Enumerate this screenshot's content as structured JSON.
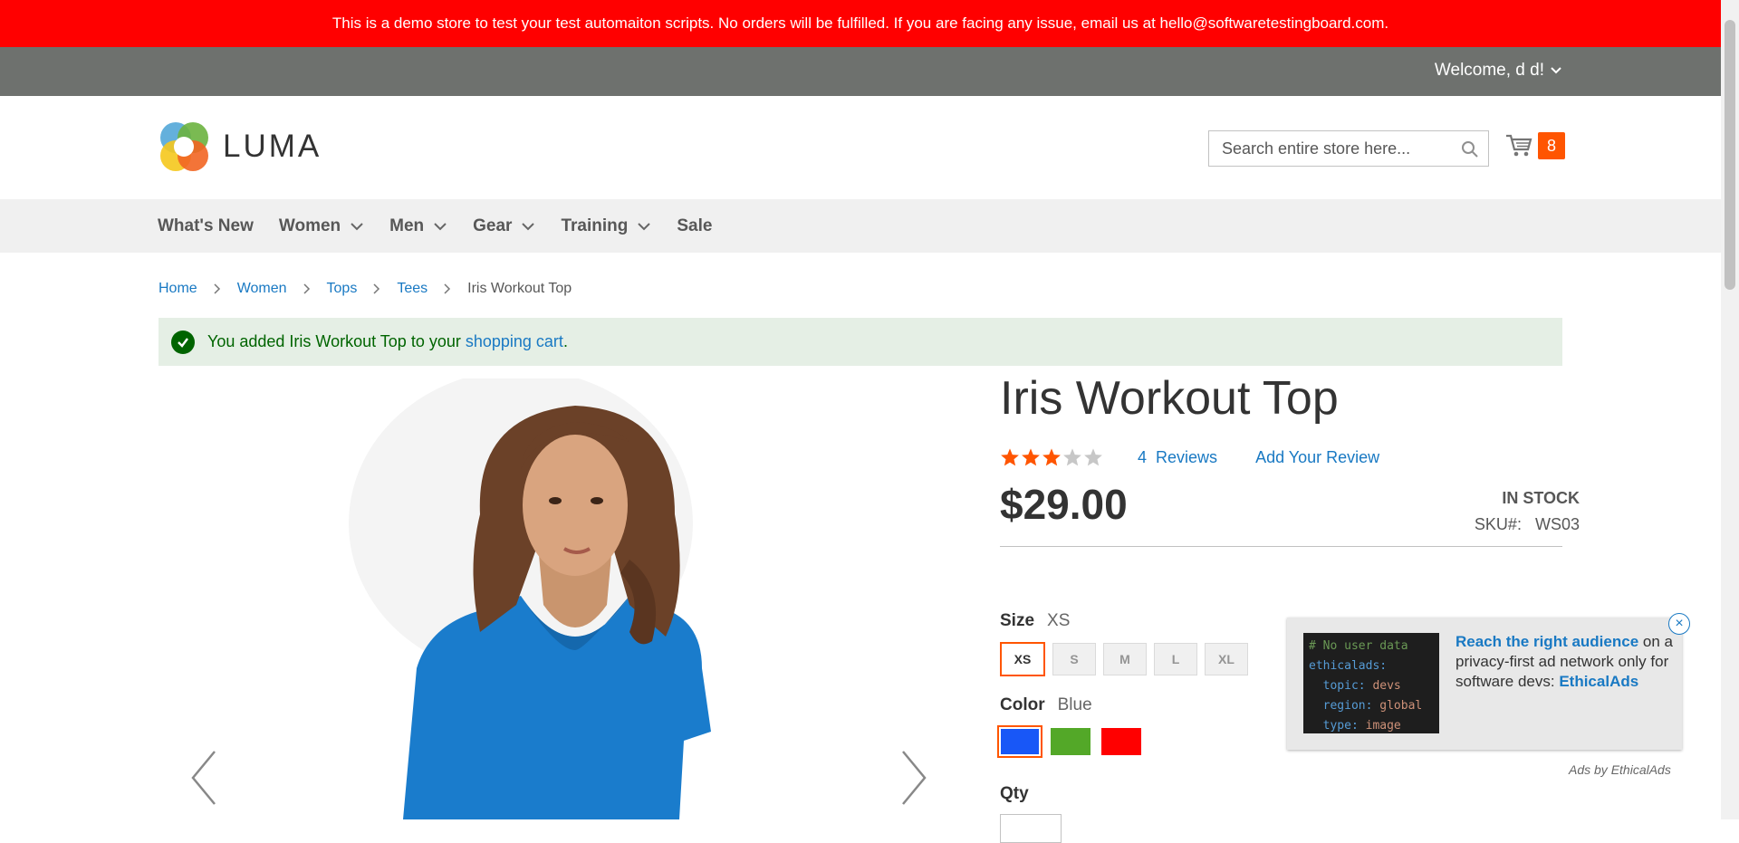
{
  "demo_notice": "This is a demo store to test your test automaiton scripts. No orders will be fulfilled. If you are facing any issue, email us at hello@softwaretestingboard.com.",
  "header": {
    "welcome": "Welcome, d d!",
    "logo_text": "LUMA",
    "search_placeholder": "Search entire store here...",
    "cart_count": "8"
  },
  "nav": {
    "items": [
      {
        "label": "What's New"
      },
      {
        "label": "Women"
      },
      {
        "label": "Men"
      },
      {
        "label": "Gear"
      },
      {
        "label": "Training"
      },
      {
        "label": "Sale"
      }
    ]
  },
  "breadcrumbs": [
    "Home",
    "Women",
    "Tops",
    "Tees",
    "Iris Workout Top"
  ],
  "message": {
    "prefix": "You added Iris Workout Top to your ",
    "link": "shopping cart",
    "suffix": "."
  },
  "product": {
    "title": "Iris Workout Top",
    "rating_stars": 3,
    "rating_max": 5,
    "reviews_count": "4",
    "reviews_label": "Reviews",
    "add_review": "Add Your Review",
    "price": "$29.00",
    "stock": "IN STOCK",
    "sku_label": "SKU#:",
    "sku_value": "WS03"
  },
  "options": {
    "size_label": "Size",
    "size_selected": "XS",
    "sizes": [
      "XS",
      "S",
      "M",
      "L",
      "XL"
    ],
    "color_label": "Color",
    "color_selected": "Blue",
    "colors": [
      "#1857f7",
      "#53a828",
      "#ff0000"
    ],
    "qty_label": "Qty"
  },
  "ad": {
    "code": [
      {
        "text": "# No user data"
      },
      {
        "text": "ethicalads:"
      },
      {
        "key": "topic:",
        "val": "devs"
      },
      {
        "key": "region:",
        "val": "global"
      },
      {
        "key": "type:",
        "val": "image"
      }
    ],
    "headline": "Reach the right audience",
    "body": " on a privacy-first ad network only for software devs: ",
    "brand": "EthicalAds",
    "close": "×",
    "byline": "Ads by EthicalAds"
  }
}
